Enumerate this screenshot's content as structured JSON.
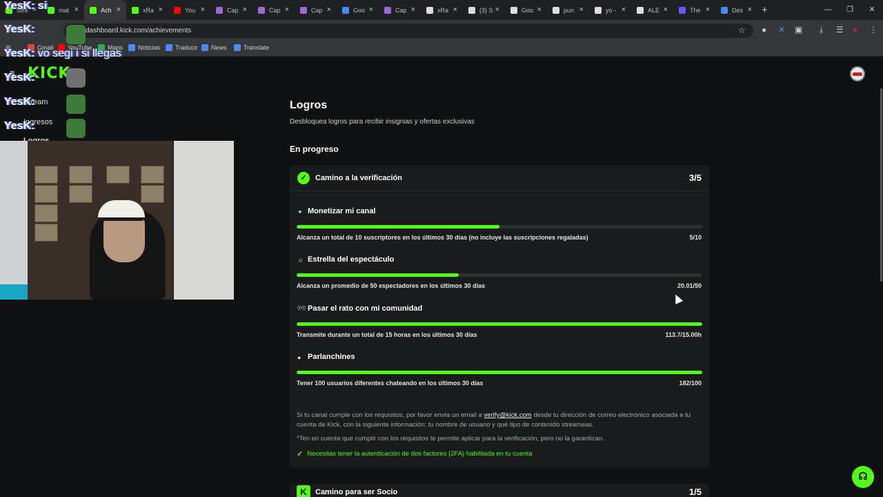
{
  "browser": {
    "tabs": [
      {
        "label": "Stre",
        "color": "#53fc18",
        "active": false
      },
      {
        "label": "mat",
        "color": "#53fc18",
        "active": false
      },
      {
        "label": "Ach",
        "color": "#53fc18",
        "active": true
      },
      {
        "label": "xRa",
        "color": "#53fc18",
        "active": false
      },
      {
        "label": "You",
        "color": "#ff0000",
        "active": false
      },
      {
        "label": "Cap",
        "color": "#9b6ad6",
        "active": false
      },
      {
        "label": "Cap",
        "color": "#9b6ad6",
        "active": false
      },
      {
        "label": "Cap",
        "color": "#9b6ad6",
        "active": false
      },
      {
        "label": "Goo",
        "color": "#4d8af0",
        "active": false
      },
      {
        "label": "Cap",
        "color": "#9b6ad6",
        "active": false
      },
      {
        "label": "xRa",
        "color": "#dddddd",
        "active": false
      },
      {
        "label": "(3) S",
        "color": "#dddddd",
        "active": false
      },
      {
        "label": "Goo",
        "color": "#dddddd",
        "active": false
      },
      {
        "label": "pun",
        "color": "#dddddd",
        "active": false
      },
      {
        "label": "yo -",
        "color": "#dddddd",
        "active": false
      },
      {
        "label": "ALE",
        "color": "#dddddd",
        "active": false
      },
      {
        "label": "The",
        "color": "#6a5af0",
        "active": false
      },
      {
        "label": "Des",
        "color": "#4d8af0",
        "active": false
      }
    ],
    "url": "dashboard.kick.com/achievements",
    "bookmarks": [
      "Gmail",
      "YouTube",
      "Maps",
      "Noticias",
      "Traducir",
      "News",
      "Translate"
    ]
  },
  "overlay": {
    "chat": [
      {
        "user": "YesK:",
        "msg": "si"
      },
      {
        "user": "YesK:",
        "msg": ""
      },
      {
        "user": "YesK:",
        "msg": "vo segi i si llegas"
      },
      {
        "user": "YesK:",
        "msg": ""
      },
      {
        "user": "YesK:",
        "msg": ""
      },
      {
        "user": "YesK:",
        "msg": ""
      }
    ],
    "logo": "KICK",
    "sidebar_items": [
      "Stream",
      "Ingresos",
      "Logros"
    ]
  },
  "page": {
    "title": "Logros",
    "subtitle": "Desbloquea logros para recibir insignias y ofertas exclusivas",
    "section": "En progreso"
  },
  "verification": {
    "title": "Camino a la verificación",
    "count": "3/5",
    "goals": [
      {
        "icon": "sparkle-icon",
        "glyph": "✦",
        "title": "Monetizar mi canal",
        "desc": "Alcanza un total de 10 suscriptores en los últimos 30 días (no incluye las suscripciones regaladas)",
        "value": "5/10",
        "progress": 0.5
      },
      {
        "icon": "users-icon",
        "glyph": "☺",
        "title": "Estrella del espectáculo",
        "desc": "Alcanza un promedio de 50 espectadores en los últimos 30 días",
        "value": "20.01/50",
        "progress": 0.4
      },
      {
        "icon": "broadcast-icon",
        "glyph": "((•))",
        "title": "Pasar el rato con mi comunidad",
        "desc": "Transmite durante un total de 15 horas en los últimos 30 días",
        "value": "113.7/15.00h",
        "progress": 1.0
      },
      {
        "icon": "chat-icon",
        "glyph": "●",
        "title": "Parlanchines",
        "desc": "Tener 100 usuarios diferentes chateando en los últimos 30 días",
        "value": "182/100",
        "progress": 1.0
      }
    ],
    "note_pre": "Si tu canal cumple con los requisitos, por favor envía un email a",
    "note_email": "verify@kick.com",
    "note_post": "desde tu dirección de correo electrónico asociada a tu cuenta de Kick, con la siguiente información: tu nombre de usuario y qué tipo de contenido streameas.",
    "disclaimer": "*Ten en cuenta que cumplir con los requisitos te permite aplicar para la verificación, pero no la garantizan.",
    "requirement": "Necesitas tener la autenticación de dos factores (2FA) habilitada en tu cuenta"
  },
  "partner": {
    "title": "Camino para ser Socio",
    "count": "1/5"
  },
  "colors": {
    "accent": "#53fc18",
    "background": "#101112",
    "card": "#191b1c"
  }
}
